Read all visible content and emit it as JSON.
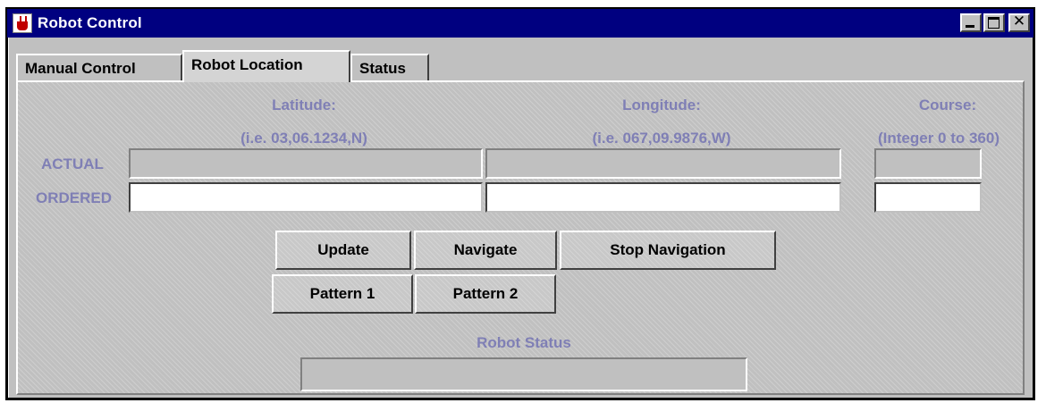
{
  "window": {
    "title": "Robot Control"
  },
  "titlebar_buttons": {
    "close_glyph": "✕"
  },
  "tabs": [
    {
      "label": "Manual Control",
      "active": false
    },
    {
      "label": "Robot Location",
      "active": true
    },
    {
      "label": "Status",
      "active": false
    }
  ],
  "columns": {
    "latitude": {
      "label": "Latitude:",
      "hint": "(i.e. 03,06.1234,N)"
    },
    "longitude": {
      "label": "Longitude:",
      "hint": "(i.e. 067,09.9876,W)"
    },
    "course": {
      "label": "Course:",
      "hint": "(Integer 0 to 360)"
    }
  },
  "rows": {
    "actual": "ACTUAL",
    "ordered": "ORDERED"
  },
  "values": {
    "actual_latitude": "",
    "actual_longitude": "",
    "actual_course": "",
    "ordered_latitude": "",
    "ordered_longitude": "",
    "ordered_course": ""
  },
  "buttons": {
    "update": "Update",
    "navigate": "Navigate",
    "stop_navigation": "Stop Navigation",
    "pattern1": "Pattern 1",
    "pattern2": "Pattern 2"
  },
  "robot_status": {
    "label": "Robot Status",
    "value": ""
  },
  "colors": {
    "titlebar": "#000080",
    "label": "#7f7fb5",
    "face": "#c0c0c0"
  }
}
